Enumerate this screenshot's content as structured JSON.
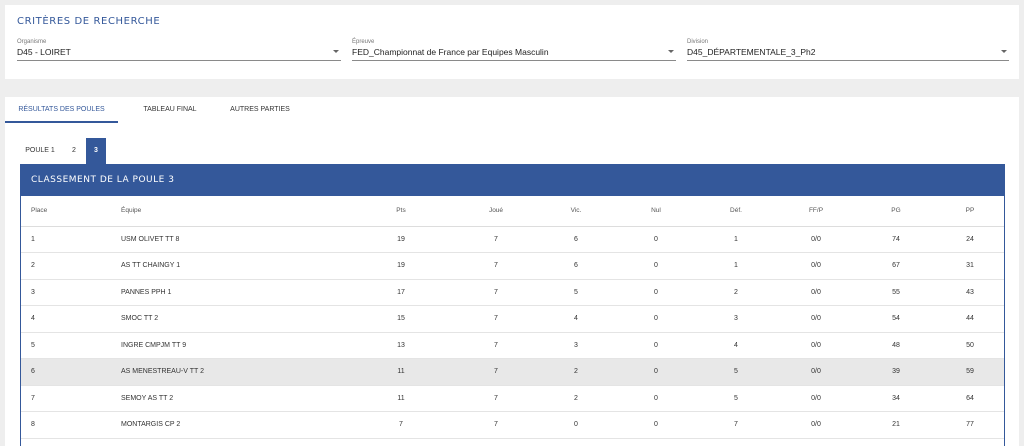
{
  "search": {
    "title": "CRITÈRES DE RECHERCHE",
    "fields": [
      {
        "label": "Organisme",
        "value": "D45 - LOIRET"
      },
      {
        "label": "Épreuve",
        "value": "FED_Championnat de France par Equipes Masculin"
      },
      {
        "label": "Division",
        "value": "D45_DÉPARTEMENTALE_3_Ph2"
      }
    ]
  },
  "tabs": [
    "RÉSULTATS DES POULES",
    "TABLEAU FINAL",
    "AUTRES PARTIES"
  ],
  "subtabs": [
    "POULE 1",
    "2",
    "3"
  ],
  "table": {
    "title": "CLASSEMENT DE LA POULE 3",
    "columns": [
      "Place",
      "Équipe",
      "Pts",
      "Joué",
      "Vic.",
      "Nul",
      "Déf.",
      "FF/P",
      "PG",
      "PP"
    ],
    "rows": [
      [
        "1",
        "USM OLIVET TT 8",
        "19",
        "7",
        "6",
        "0",
        "1",
        "0/0",
        "74",
        "24"
      ],
      [
        "2",
        "AS TT CHAINGY 1",
        "19",
        "7",
        "6",
        "0",
        "1",
        "0/0",
        "67",
        "31"
      ],
      [
        "3",
        "PANNES PPH 1",
        "17",
        "7",
        "5",
        "0",
        "2",
        "0/0",
        "55",
        "43"
      ],
      [
        "4",
        "SMOC TT 2",
        "15",
        "7",
        "4",
        "0",
        "3",
        "0/0",
        "54",
        "44"
      ],
      [
        "5",
        "INGRE CMPJM TT 9",
        "13",
        "7",
        "3",
        "0",
        "4",
        "0/0",
        "48",
        "50"
      ],
      [
        "6",
        "AS MENESTREAU-V TT 2",
        "11",
        "7",
        "2",
        "0",
        "5",
        "0/0",
        "39",
        "59"
      ],
      [
        "7",
        "SEMOY AS TT 2",
        "11",
        "7",
        "2",
        "0",
        "5",
        "0/0",
        "34",
        "64"
      ],
      [
        "8",
        "MONTARGIS CP 2",
        "7",
        "7",
        "0",
        "0",
        "7",
        "0/0",
        "21",
        "77"
      ]
    ]
  }
}
